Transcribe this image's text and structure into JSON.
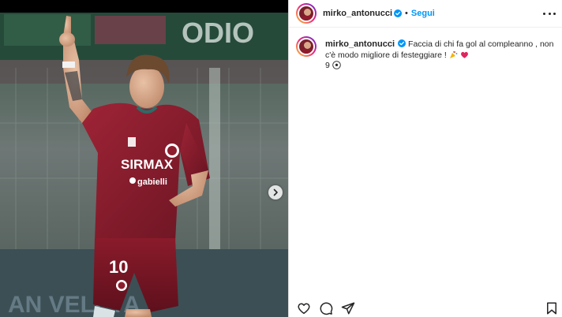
{
  "post": {
    "author": {
      "username": "mirko_antonucci",
      "verified": true,
      "follow_label": "Segui",
      "separator": "•"
    },
    "caption": {
      "line1": "Faccia di chi fa gol al compleanno , non c'è modo migliore di festeggiare !",
      "line2": "9"
    },
    "media": {
      "jersey_text": "SIRMAX",
      "sponsor_text": "gabielli",
      "shirt_number": "10",
      "stadium_text": "ODIO",
      "board_text": "AN VELETA"
    }
  },
  "icons": {
    "like": "heart-icon",
    "comment": "comment-icon",
    "share": "share-icon",
    "save": "bookmark-icon",
    "more": "more-options-icon",
    "next": "chevron-right-icon"
  },
  "colors": {
    "follow": "#0095f6",
    "verified": "#0095f6",
    "jersey": "#8e1c2c",
    "text": "#262626"
  }
}
